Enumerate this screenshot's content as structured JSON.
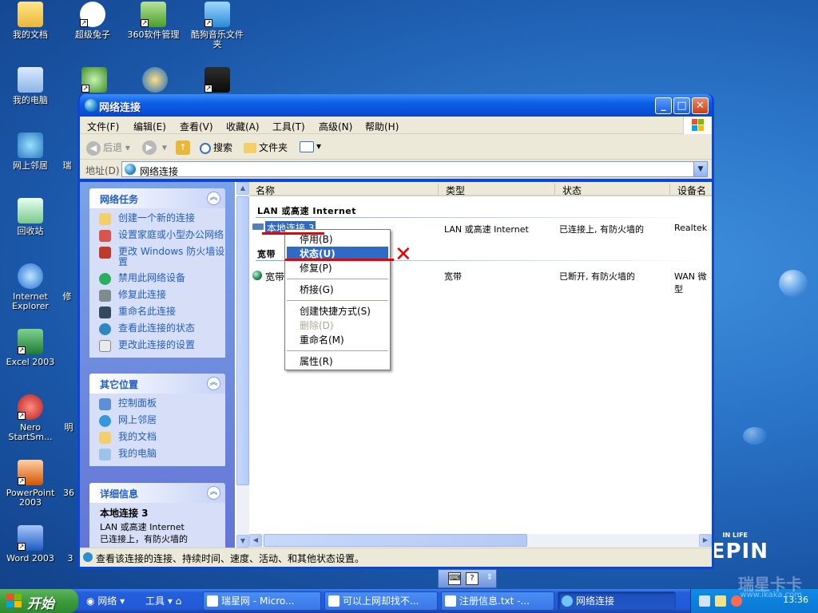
{
  "desktop": {
    "icons": [
      {
        "label": "我的文档",
        "color": "#f2c94c"
      },
      {
        "label": "超级兔子",
        "color": "#ffffff"
      },
      {
        "label": "360软件管理",
        "color": "#6abf4b"
      },
      {
        "label": "酷狗音乐文件夹",
        "color": "#4aa3df"
      },
      {
        "label": "我的电脑",
        "color": "#9cc3ea"
      },
      {
        "label": "网上邻居",
        "color": "#4aa3df"
      },
      {
        "label": "回收站",
        "color": "#2f9e44"
      },
      {
        "label": "Internet Explorer",
        "color": "#2e7cd6"
      },
      {
        "label": "Excel 2003",
        "color": "#1e7b34"
      },
      {
        "label": "Nero StartSm...",
        "color": "#c62828"
      },
      {
        "label": "PowerPoint 2003",
        "color": "#d35400"
      },
      {
        "label": "Word 2003",
        "color": "#1e5bbf"
      }
    ],
    "partial_labels": [
      "瑞",
      "修",
      "明",
      "36",
      "3"
    ],
    "watermark": {
      "inlife": "IN LIFE",
      "brand": "EEPIN",
      "site": "瑞星卡卡",
      "url": "www.ikaka.com"
    }
  },
  "window": {
    "title": "网络连接",
    "title_buttons": {
      "min": "_",
      "max": "□",
      "close": "✕"
    },
    "menu": [
      "文件(F)",
      "编辑(E)",
      "查看(V)",
      "收藏(A)",
      "工具(T)",
      "高级(N)",
      "帮助(H)"
    ],
    "toolbar": {
      "back": "后退",
      "forward": "",
      "search": "搜索",
      "folders": "文件夹"
    },
    "address": {
      "label": "地址(D)",
      "value": "网络连接"
    },
    "tasks": {
      "network": {
        "title": "网络任务",
        "items": [
          "创建一个新的连接",
          "设置家庭或小型办公网络",
          "更改 Windows 防火墙设置",
          "禁用此网络设备",
          "修复此连接",
          "重命名此连接",
          "查看此连接的状态",
          "更改此连接的设置"
        ]
      },
      "other": {
        "title": "其它位置",
        "items": [
          "控制面板",
          "网上邻居",
          "我的文档",
          "我的电脑"
        ]
      },
      "details": {
        "title": "详细信息",
        "name": "本地连接 3",
        "type": "LAN 或高速 Internet",
        "status": "已连接上，有防火墙的"
      }
    },
    "columns": [
      "名称",
      "类型",
      "状态",
      "设备名"
    ],
    "groups": [
      {
        "title": "LAN 或高速 Internet",
        "rows": [
          {
            "name": "本地连接 3",
            "type": "LAN 或高速 Internet",
            "status": "已连接上, 有防火墙的",
            "device": "Realtek"
          }
        ]
      },
      {
        "title": "宽带",
        "rows": [
          {
            "name": "宽带",
            "type": "宽带",
            "status": "已断开, 有防火墙的",
            "device": "WAN 微型"
          }
        ]
      }
    ],
    "context_menu": {
      "items": [
        "停用(B)",
        "状态(U)",
        "修复(P)",
        "桥接(G)",
        "创建快捷方式(S)",
        "删除(D)",
        "重命名(M)",
        "属性(R)"
      ],
      "highlighted": "状态(U)",
      "disabled": [
        "删除(D)"
      ]
    },
    "status_text": "查看该连接的连接、持续时间、速度、活动、和其他状态设置。"
  },
  "taskbar": {
    "start": "开始",
    "quick": [
      "网络",
      "工具"
    ],
    "tasks": [
      "瑞星网 - Micro...",
      "可以上网却找不...",
      "注册信息.txt -...",
      "网络连接"
    ],
    "active_task": "网络连接",
    "clock": "13:36"
  }
}
